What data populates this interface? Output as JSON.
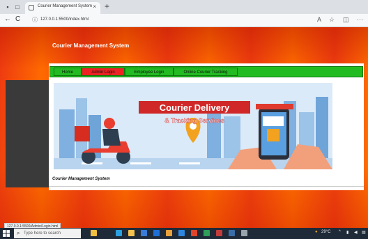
{
  "browser": {
    "tab_title": "Courier Management System",
    "close_glyph": "×",
    "new_tab_glyph": "+",
    "back_glyph": "←",
    "reload_glyph": "C",
    "url": "127.0.0.1:5500/index.html"
  },
  "page": {
    "site_title": "Courier Management System",
    "menu": [
      {
        "label": "Home",
        "color": "#22bb22"
      },
      {
        "label": "Admin Login",
        "color": "#ee2222"
      },
      {
        "label": "Employee Login",
        "color": "#22bb22"
      },
      {
        "label": "Online Courier Tracking",
        "color": "#22bb22"
      }
    ],
    "banner": {
      "title": "Courier Delivery",
      "subtitle": "& Tracking Services"
    },
    "footer_text": "Courier Management System",
    "status_url": "127.0.0.1:5500/Admin/Login.html"
  },
  "taskbar": {
    "search_placeholder": "Type here to search",
    "weather": "29°C",
    "icons": [
      "task-view-icon",
      "edge-icon",
      "file-explorer-icon",
      "store-icon",
      "mail-icon",
      "chrome-icon",
      "vscode-icon",
      "office-icon",
      "photos-icon",
      "settings-icon",
      "terminal-icon",
      "app-icon"
    ]
  },
  "colors": {
    "accent_green": "#22bb22",
    "accent_red": "#ee2222",
    "bg_orange": "#ff6a00",
    "bg_red": "#ee3b10"
  }
}
